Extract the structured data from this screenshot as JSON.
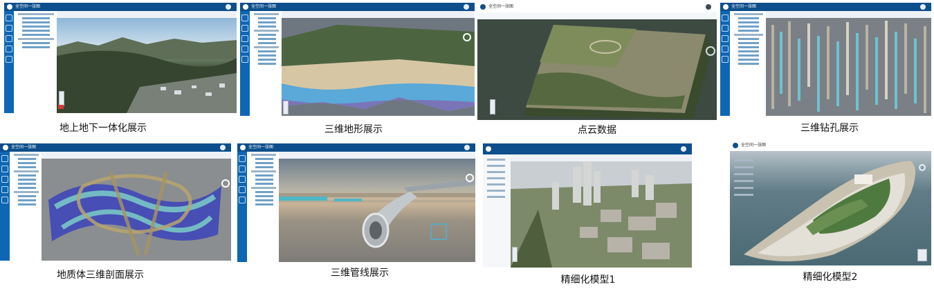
{
  "app": {
    "title": "全空间一张图"
  },
  "panels": [
    {
      "caption": "地上地下一体化展示"
    },
    {
      "caption": "三维地形展示"
    },
    {
      "caption": "点云数据"
    },
    {
      "caption": "三维钻孔展示"
    },
    {
      "caption": "地质体三维剖面展示"
    },
    {
      "caption": "三维管线展示"
    },
    {
      "caption": "精细化模型1"
    },
    {
      "caption": "精细化模型2"
    }
  ],
  "colors": {
    "header": "#0d4f8c",
    "iconbar": "#0f66b3",
    "toolbar": "#eef2f6"
  },
  "icons": [
    "logo-icon",
    "user-avatar-icon",
    "compass-icon",
    "zoom-control-icon"
  ]
}
